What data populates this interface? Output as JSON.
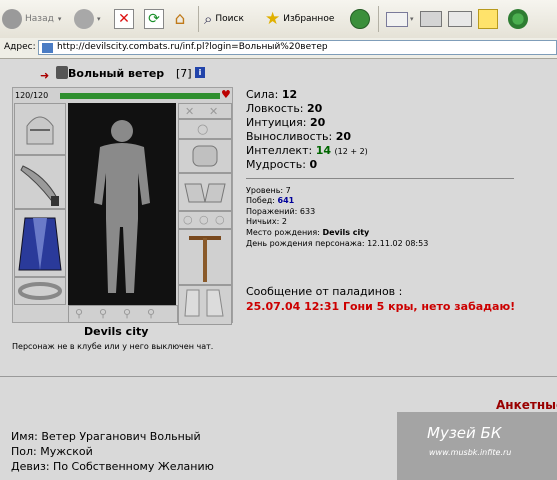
{
  "toolbar": {
    "back_label": "Назад",
    "search_label": "Поиск",
    "favorites_label": "Избранное"
  },
  "address": {
    "label": "Адрес:",
    "url": "http://devilscity.combats.ru/inf.pl?login=Вольный%20ветер"
  },
  "character": {
    "name": "Вольный ветер",
    "level_bracket": "[7]",
    "info_badge": "i",
    "hp": "120/120",
    "city": "Devils city",
    "status_note": "Персонаж не в клубе или у него выключен чат."
  },
  "stats": [
    {
      "label": "Сила:",
      "value": "12"
    },
    {
      "label": "Ловкость:",
      "value": "20"
    },
    {
      "label": "Интуиция:",
      "value": "20"
    },
    {
      "label": "Выносливость:",
      "value": "20"
    },
    {
      "label": "Интеллект:",
      "value": "14",
      "extra": "(12 + 2)"
    },
    {
      "label": "Мудрость:",
      "value": "0"
    }
  ],
  "info": {
    "level": "Уровень: 7",
    "wins_label": "Побед:",
    "wins": "641",
    "losses": "Поражений: 633",
    "draws": "Ничьих: 2",
    "birthplace_label": "Место рождения:",
    "birthplace": "Devils city",
    "birthday": "День рождения персонажа: 12.11.02 08:53"
  },
  "message": {
    "title": "Сообщение от паладинов :",
    "text": "25.07.04 12:31 Гони 5 кры, нето забадаю!"
  },
  "anketa": {
    "heading": "Анкетные",
    "name": "Имя: Ветер Ураганович Вольный",
    "sex": "Пол: Мужской",
    "motto": "Девиз: По Собственному Желанию"
  },
  "watermark": {
    "line1": "Музей БК",
    "line2": "www.musbk.infite.ru"
  },
  "colors": {
    "hp_bar": "#2f8f2f",
    "message_text": "#cc0000",
    "anketa_heading": "#990000",
    "wins_value": "#000099",
    "intellect_value": "#006600"
  }
}
